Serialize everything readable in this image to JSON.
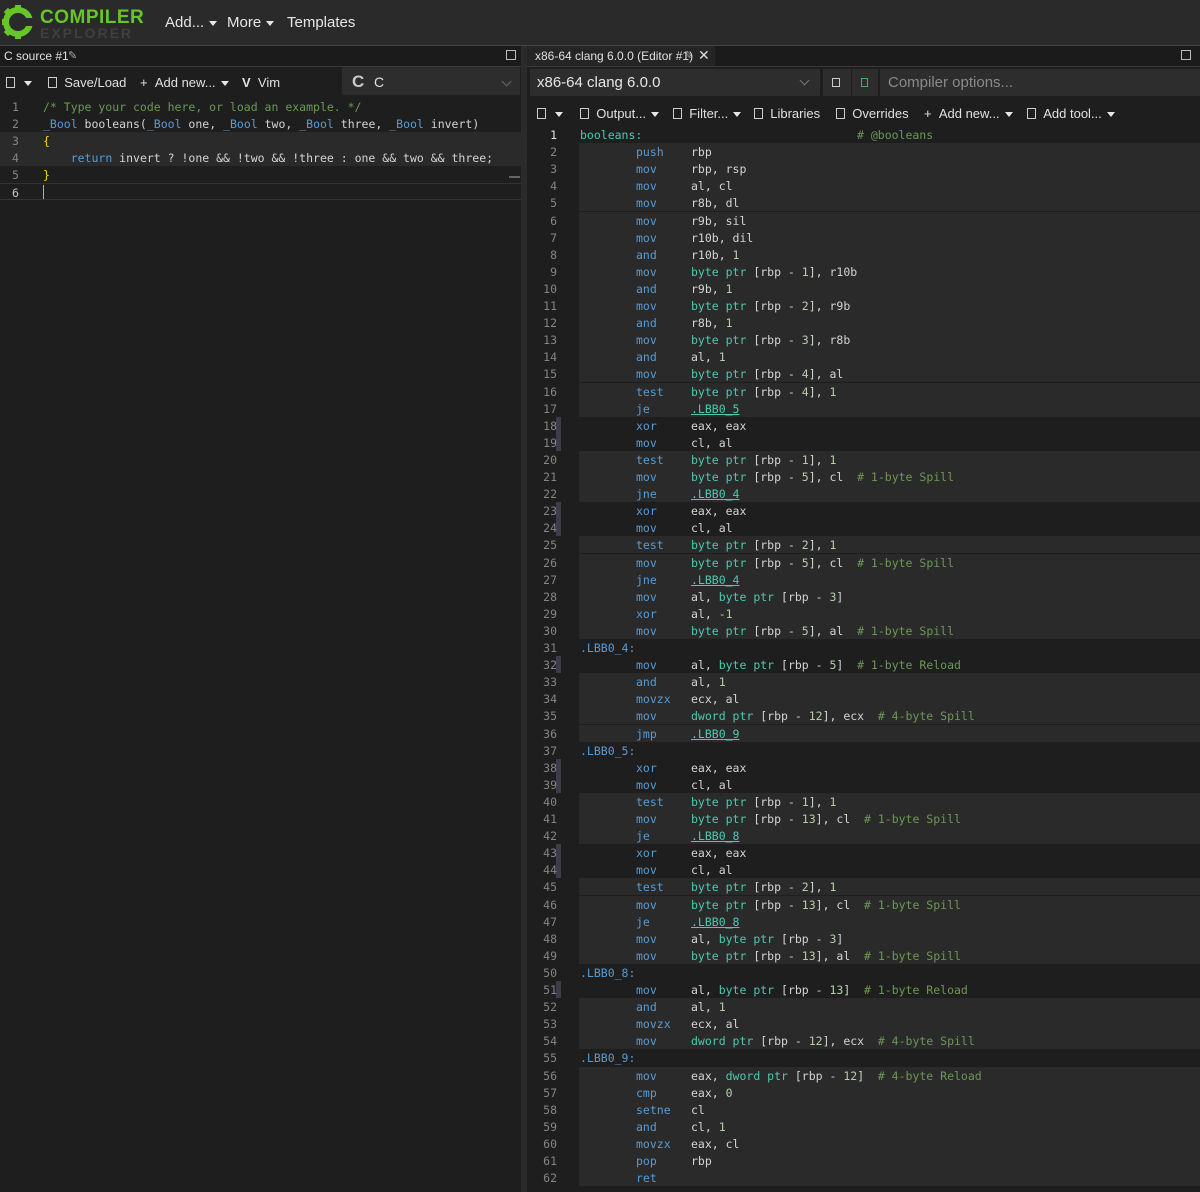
{
  "navbar": {
    "logo_top": "COMPILER",
    "logo_bottom": "EXPLORER",
    "add": "Add...",
    "more": "More",
    "templates": "Templates"
  },
  "source_pane": {
    "tab_title": "C source #1",
    "toolbar": {
      "save_load": "Save/Load",
      "add_new": "Add new...",
      "vim": "Vim"
    },
    "language": "C",
    "lines": [
      "/* Type your code here, or load an example. */",
      "_Bool booleans(_Bool one, _Bool two, _Bool three, _Bool invert)",
      "{",
      "    return invert ? !one && !two && !three : one && two && three;",
      "}",
      ""
    ]
  },
  "compiler_pane": {
    "tab_title": "x86-64 clang 6.0.0 (Editor #1)",
    "compiler_name": "x86-64 clang 6.0.0",
    "options_placeholder": "Compiler options...",
    "toolbar": {
      "output": "Output...",
      "filter": "Filter...",
      "libraries": "Libraries",
      "overrides": "Overrides",
      "add_new": "Add new...",
      "add_tool": "Add tool..."
    },
    "asm_lines": [
      {
        "label": "booleans:",
        "comment": "# @booleans"
      },
      {
        "op": "push",
        "args": "rbp"
      },
      {
        "op": "mov",
        "args": "rbp, rsp"
      },
      {
        "op": "mov",
        "args": "al, cl"
      },
      {
        "op": "mov",
        "args": "r8b, dl"
      },
      {
        "op": "mov",
        "args": "r9b, sil"
      },
      {
        "op": "mov",
        "args": "r10b, dil"
      },
      {
        "op": "and",
        "args": "r10b, 1"
      },
      {
        "op": "mov",
        "args": "byte ptr [rbp - 1], r10b"
      },
      {
        "op": "and",
        "args": "r9b, 1"
      },
      {
        "op": "mov",
        "args": "byte ptr [rbp - 2], r9b"
      },
      {
        "op": "and",
        "args": "r8b, 1"
      },
      {
        "op": "mov",
        "args": "byte ptr [rbp - 3], r8b"
      },
      {
        "op": "and",
        "args": "al, 1"
      },
      {
        "op": "mov",
        "args": "byte ptr [rbp - 4], al"
      },
      {
        "op": "test",
        "args": "byte ptr [rbp - 4], 1"
      },
      {
        "op": "je",
        "args": ".LBB0_5"
      },
      {
        "op": "xor",
        "args": "eax, eax"
      },
      {
        "op": "mov",
        "args": "cl, al"
      },
      {
        "op": "test",
        "args": "byte ptr [rbp - 1], 1"
      },
      {
        "op": "mov",
        "args": "byte ptr [rbp - 5], cl",
        "comment": "# 1-byte Spill"
      },
      {
        "op": "jne",
        "args": ".LBB0_4"
      },
      {
        "op": "xor",
        "args": "eax, eax"
      },
      {
        "op": "mov",
        "args": "cl, al"
      },
      {
        "op": "test",
        "args": "byte ptr [rbp - 2], 1"
      },
      {
        "op": "mov",
        "args": "byte ptr [rbp - 5], cl",
        "comment": "# 1-byte Spill"
      },
      {
        "op": "jne",
        "args": ".LBB0_4"
      },
      {
        "op": "mov",
        "args": "al, byte ptr [rbp - 3]"
      },
      {
        "op": "xor",
        "args": "al, -1"
      },
      {
        "op": "mov",
        "args": "byte ptr [rbp - 5], al",
        "comment": "# 1-byte Spill"
      },
      {
        "label": ".LBB0_4:"
      },
      {
        "op": "mov",
        "args": "al, byte ptr [rbp - 5]",
        "comment": "# 1-byte Reload"
      },
      {
        "op": "and",
        "args": "al, 1"
      },
      {
        "op": "movzx",
        "args": "ecx, al"
      },
      {
        "op": "mov",
        "args": "dword ptr [rbp - 12], ecx",
        "comment": "# 4-byte Spill"
      },
      {
        "op": "jmp",
        "args": ".LBB0_9"
      },
      {
        "label": ".LBB0_5:"
      },
      {
        "op": "xor",
        "args": "eax, eax"
      },
      {
        "op": "mov",
        "args": "cl, al"
      },
      {
        "op": "test",
        "args": "byte ptr [rbp - 1], 1"
      },
      {
        "op": "mov",
        "args": "byte ptr [rbp - 13], cl",
        "comment": "# 1-byte Spill"
      },
      {
        "op": "je",
        "args": ".LBB0_8"
      },
      {
        "op": "xor",
        "args": "eax, eax"
      },
      {
        "op": "mov",
        "args": "cl, al"
      },
      {
        "op": "test",
        "args": "byte ptr [rbp - 2], 1"
      },
      {
        "op": "mov",
        "args": "byte ptr [rbp - 13], cl",
        "comment": "# 1-byte Spill"
      },
      {
        "op": "je",
        "args": ".LBB0_8"
      },
      {
        "op": "mov",
        "args": "al, byte ptr [rbp - 3]"
      },
      {
        "op": "mov",
        "args": "byte ptr [rbp - 13], al",
        "comment": "# 1-byte Spill"
      },
      {
        "label": ".LBB0_8:"
      },
      {
        "op": "mov",
        "args": "al, byte ptr [rbp - 13]",
        "comment": "# 1-byte Reload"
      },
      {
        "op": "and",
        "args": "al, 1"
      },
      {
        "op": "movzx",
        "args": "ecx, al"
      },
      {
        "op": "mov",
        "args": "dword ptr [rbp - 12], ecx",
        "comment": "# 4-byte Spill"
      },
      {
        "label": ".LBB0_9:"
      },
      {
        "op": "mov",
        "args": "eax, dword ptr [rbp - 12]",
        "comment": "# 4-byte Reload"
      },
      {
        "op": "cmp",
        "args": "eax, 0"
      },
      {
        "op": "setne",
        "args": "cl"
      },
      {
        "op": "and",
        "args": "cl, 1"
      },
      {
        "op": "movzx",
        "args": "eax, cl"
      },
      {
        "op": "pop",
        "args": "rbp"
      },
      {
        "op": "ret",
        "args": ""
      }
    ]
  },
  "colors": {
    "brand_green": "#67c52a",
    "keyword_blue": "#569cd6",
    "type_teal": "#4ec9b0",
    "comment_green": "#6a9955",
    "number_light": "#b5cea8"
  }
}
